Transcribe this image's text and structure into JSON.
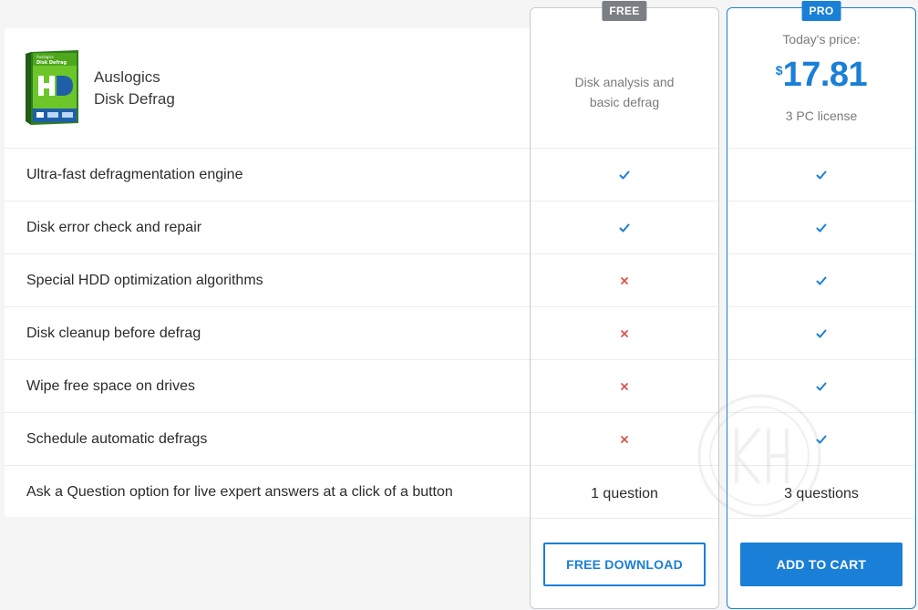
{
  "product": {
    "name_line1": "Auslogics",
    "name_line2": "Disk Defrag",
    "box_brand": "Auslogics",
    "box_title": "Disk Defrag"
  },
  "features": [
    {
      "label": "Ultra-fast defragmentation engine",
      "free": "check",
      "pro": "check"
    },
    {
      "label": "Disk error check and repair",
      "free": "check",
      "pro": "check"
    },
    {
      "label": "Special HDD optimization algorithms",
      "free": "cross",
      "pro": "check"
    },
    {
      "label": "Disk cleanup before defrag",
      "free": "cross",
      "pro": "check"
    },
    {
      "label": "Wipe free space on drives",
      "free": "cross",
      "pro": "check"
    },
    {
      "label": "Schedule automatic defrags",
      "free": "cross",
      "pro": "check"
    },
    {
      "label": "Ask a Question option for live expert answers at a click of a button",
      "free": "1 question",
      "pro": "3 questions"
    }
  ],
  "plans": {
    "free": {
      "badge": "FREE",
      "description_line1": "Disk analysis and",
      "description_line2": "basic defrag",
      "button": "FREE DOWNLOAD"
    },
    "pro": {
      "badge": "PRO",
      "price_caption": "Today's price:",
      "currency": "$",
      "price": "17.81",
      "license": "3 PC license",
      "button": "ADD TO CART"
    }
  },
  "colors": {
    "accent": "#1a7fd6",
    "check": "#1a7fd6",
    "cross": "#d9534f",
    "free_border": "#c8ccd0"
  },
  "icons": {
    "check": "check-icon",
    "cross": "cross-icon"
  }
}
